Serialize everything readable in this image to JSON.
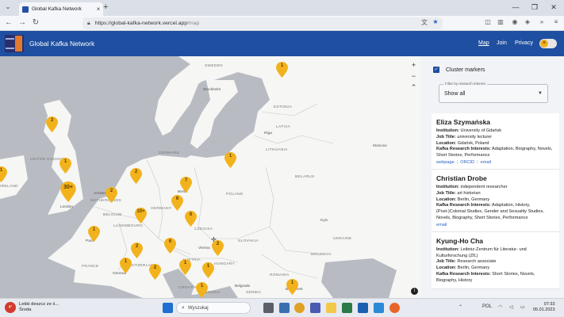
{
  "browser": {
    "tab_title": "Global Kafka Network",
    "tab_close": "×",
    "new_tab": "+",
    "url_host": "https://global-kafka-network.vercel.app",
    "url_path": "/map",
    "window_controls": [
      "—",
      "❐",
      "✕"
    ],
    "nav_icons": [
      "back-icon",
      "forward-icon",
      "reload-icon"
    ],
    "right_icons": [
      "translate-icon",
      "star-icon",
      "pocket-icon",
      "library-icon",
      "account-icon",
      "shield-icon",
      "extensions-icon",
      "more-icon"
    ]
  },
  "app": {
    "title": "Global Kafka Network",
    "nav": [
      {
        "label": "Map",
        "active": true
      },
      {
        "label": "Join",
        "active": false
      },
      {
        "label": "Privacy",
        "active": false
      }
    ],
    "theme_icon": "sun-icon",
    "brand_color": "#1f4fa0",
    "marker_color": "#f2b21c"
  },
  "map": {
    "zoom_in": "+",
    "zoom_out": "−",
    "reset": "⌃",
    "info": "i",
    "countries": [
      "SWEDEN",
      "ESTONIA",
      "LATVIA",
      "LITHUANIA",
      "BELARUS",
      "POLAND",
      "GERMANY",
      "BELGIUM",
      "LUXEMBOURG",
      "FRANCE",
      "SWITZERLAND",
      "CZECHIA",
      "SLOVAKIA",
      "AUSTRIA",
      "HUNGARY",
      "UKRAINE",
      "MOLDOVA",
      "ROMANIA",
      "SERBIA",
      "CROATIA",
      "BOSNIA",
      "IRELAND",
      "UNITED KINGDOM",
      "DENMARK",
      "NETHERLANDS"
    ],
    "cities": [
      "Stockholm",
      "Riga",
      "Moscow",
      "Kyiv",
      "Berlin",
      "London",
      "Amsterdam",
      "Paris",
      "Vienna",
      "Geneva",
      "Belgrade",
      "Bucharest"
    ],
    "markers": [
      "1",
      "3",
      "1",
      "1",
      "2",
      "7",
      "1",
      "30+",
      "2",
      "6",
      "10+",
      "6",
      "1",
      "2",
      "6",
      "2",
      "1",
      "2",
      "1",
      "1",
      "1",
      "1"
    ]
  },
  "panel": {
    "cluster_label": "Cluster markers",
    "cluster_checked": true,
    "filter_legend": "Filter by research interest",
    "filter_value": "Show all",
    "researchers": [
      {
        "name": "Eliza Szymańska",
        "institution": "University of Gdańsk",
        "job_title": "university lecturer",
        "location": "Gdańsk, Poland",
        "interests": "Adaptation, Biography, Novels, Short Stories, Performance",
        "links": [
          "webpage",
          "ORCID",
          "email"
        ]
      },
      {
        "name": "Christian Drobe",
        "institution": "independent researcher",
        "job_title": "art historian",
        "location": "Berlin, Germany",
        "interests": "Adaptation, History, (Post-)Colonial Studies, Gender and Sexuality Studies, Novels, Biography, Short Stories, Performance",
        "links": [
          "email"
        ]
      },
      {
        "name": "Kyung-Ho Cha",
        "institution": "Leibniz-Zentrum für Literatur- und Kulturforschung (ZfL)",
        "job_title": "Research associate",
        "location": "Berlin, Germany",
        "interests": "Short Stories, Novels, Biography, History",
        "links": []
      }
    ],
    "labels": {
      "institution": "Institution:",
      "job_title": "Job Title:",
      "location": "Location:",
      "interests": "Kafka Research Interests:"
    }
  },
  "taskbar": {
    "weather_badge": "4°",
    "weather_line1": "Lekki deszcz ze ś...",
    "weather_line2": "Środa",
    "search_placeholder": "Wyszukaj",
    "language": "POL",
    "time": "07:33",
    "date": "05.01.2023"
  }
}
